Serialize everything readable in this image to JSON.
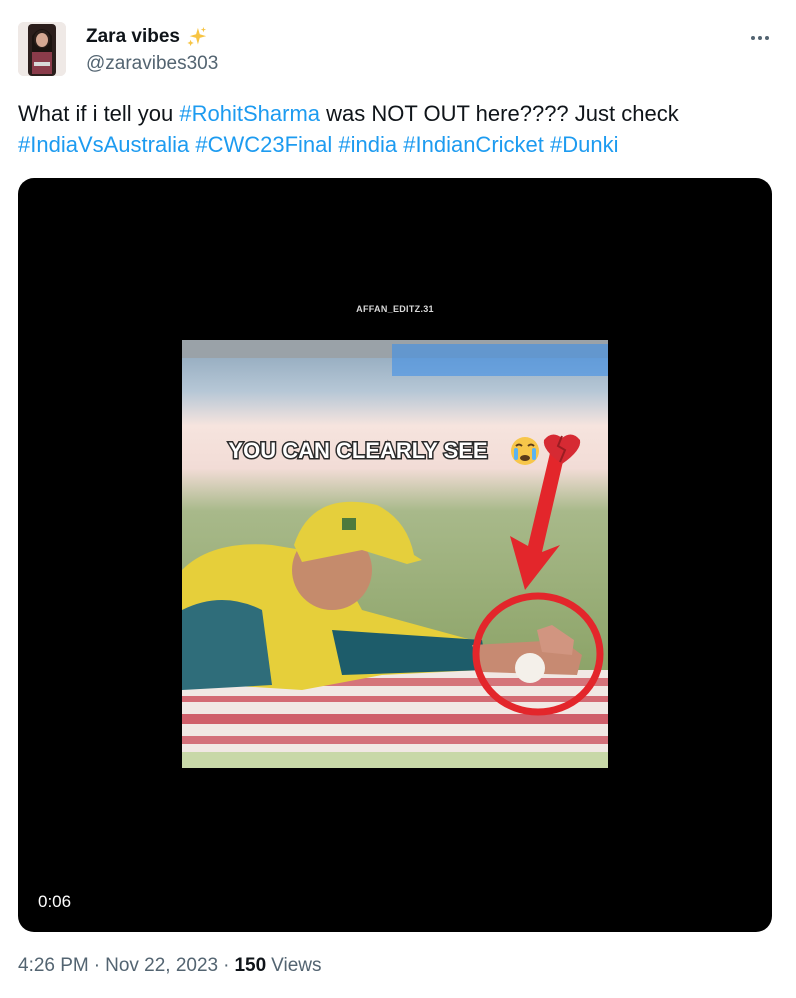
{
  "tweet": {
    "author": {
      "display_name": "Zara vibes",
      "emoji_icon": "sparkles-icon",
      "handle": "@zaravibes303"
    },
    "text_segments": [
      {
        "text": "What if i tell you ",
        "hashtag": false
      },
      {
        "text": "#RohitSharma",
        "hashtag": true
      },
      {
        "text": " was NOT OUT here???? Just check ",
        "hashtag": false
      },
      {
        "text": "#IndiaVsAustralia",
        "hashtag": true
      },
      {
        "text": " ",
        "hashtag": false
      },
      {
        "text": "#CWC23Final",
        "hashtag": true
      },
      {
        "text": " ",
        "hashtag": false
      },
      {
        "text": "#india",
        "hashtag": true
      },
      {
        "text": " ",
        "hashtag": false
      },
      {
        "text": "#IndianCricket",
        "hashtag": true
      },
      {
        "text": " ",
        "hashtag": false
      },
      {
        "text": "#Dunki",
        "hashtag": true
      }
    ],
    "media": {
      "watermark": "AFFAN_EDITZ.31",
      "overlay_caption": "YOU CAN CLEARLY SEE",
      "duration": "0:06"
    },
    "meta": {
      "time": "4:26 PM",
      "separator": "·",
      "date": "Nov 22, 2023",
      "views_count": "150",
      "views_label": "Views"
    },
    "colors": {
      "hashtag": "#1d9bf0",
      "text": "#0f1419",
      "secondary": "#536471",
      "highlight_circle": "#e3262b"
    }
  }
}
